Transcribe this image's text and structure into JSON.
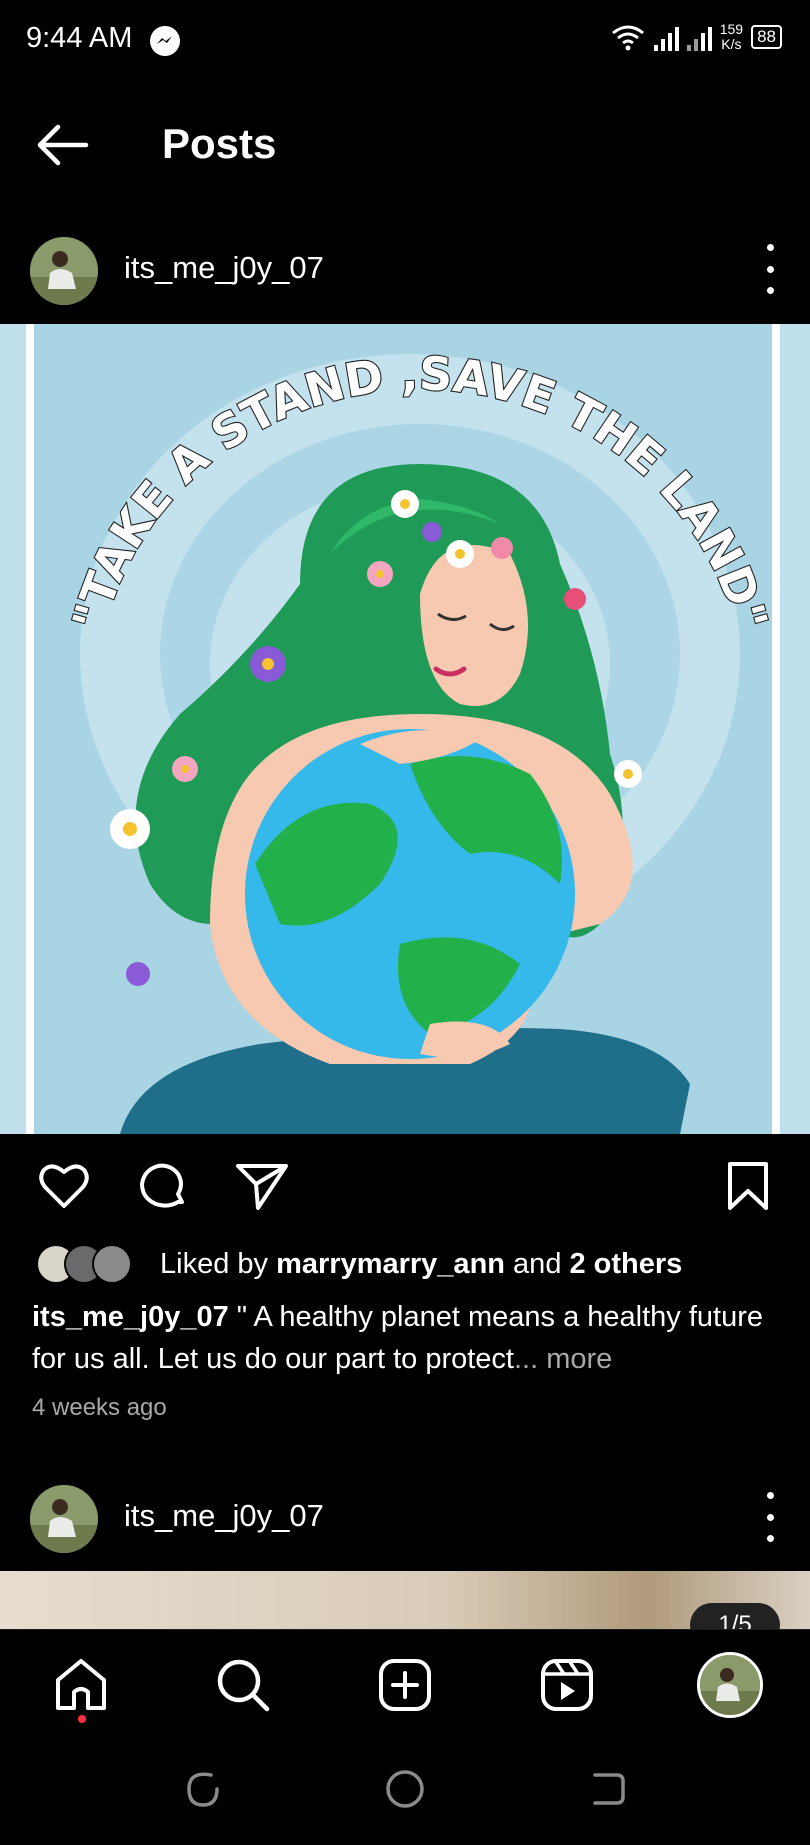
{
  "status_bar": {
    "time": "9:44 AM",
    "speed_value": "159",
    "speed_unit": "K/s",
    "battery": "88"
  },
  "top_bar": {
    "title": "Posts",
    "back_icon": "arrow-left-icon"
  },
  "post": {
    "username": "its_me_j0y_07",
    "image_text": "\"TAKE A STAND ,SAVE THE LAND\"",
    "liked_by_prefix": "Liked by ",
    "liked_by_user": "marrymarry_ann",
    "liked_by_middle": " and ",
    "liked_by_others": "2 others",
    "caption_user": "its_me_j0y_07",
    "caption_text": " \" A healthy planet means a healthy future for us all. Let us do our part to protect",
    "caption_more": "... more",
    "time_ago": "4 weeks ago"
  },
  "next_post": {
    "username": "its_me_j0y_07",
    "counter": "1/5"
  },
  "colors": {
    "background": "#000000",
    "muted_text": "#a8a8a8",
    "notification_dot": "#ff3040",
    "poster_sky": "#a9d4e4",
    "hair": "#1f9a57",
    "earth_water": "#35b8ea",
    "earth_land": "#22b04a"
  },
  "icons": {
    "like": "heart-icon",
    "comment": "comment-icon",
    "share": "send-icon",
    "save": "bookmark-icon",
    "home": "home-icon",
    "search": "search-icon",
    "create": "plus-square-icon",
    "reels": "reels-icon"
  }
}
